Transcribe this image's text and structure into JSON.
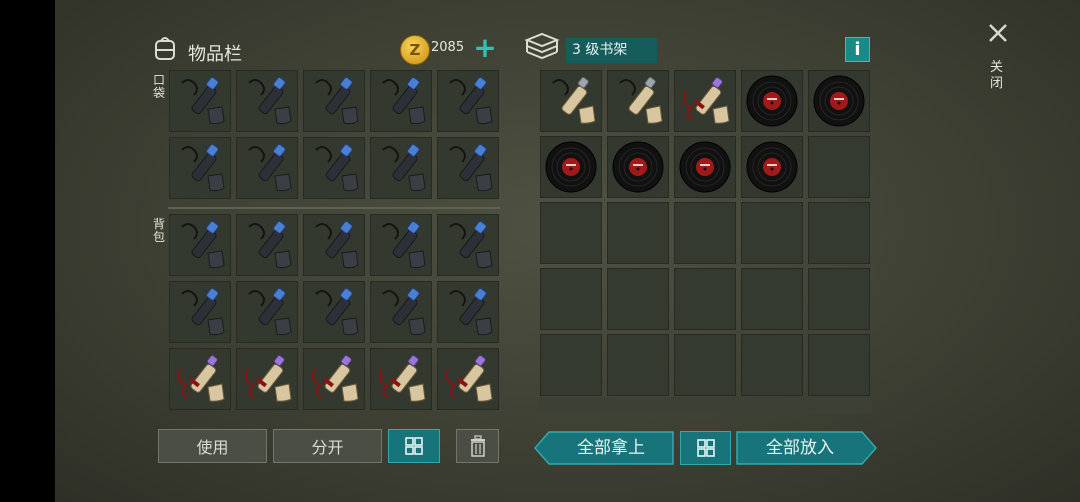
{
  "inventory": {
    "title": "物品栏",
    "coins": "2085",
    "pocket_label": "口袋",
    "backpack_label": "背包",
    "pocket_items": [
      "blue-tube",
      "blue-tube",
      "blue-tube",
      "blue-tube",
      "blue-tube",
      "blue-tube",
      "blue-tube",
      "blue-tube",
      "blue-tube",
      "blue-tube"
    ],
    "backpack_items": [
      "blue-tube",
      "blue-tube",
      "blue-tube",
      "blue-tube",
      "blue-tube",
      "blue-tube",
      "blue-tube",
      "blue-tube",
      "blue-tube",
      "blue-tube",
      "scroll-purple",
      "scroll-purple",
      "scroll-purple",
      "scroll-purple",
      "scroll-purple"
    ]
  },
  "container": {
    "title": "3 级书架",
    "items": [
      "scroll-gray",
      "scroll-gray",
      "scroll-purple",
      "vinyl-record",
      "vinyl-record",
      "vinyl-record",
      "vinyl-record",
      "vinyl-record",
      "vinyl-record",
      "",
      "",
      "",
      "",
      "",
      "",
      "",
      "",
      "",
      "",
      "",
      "",
      "",
      "",
      "",
      ""
    ]
  },
  "actions": {
    "use": "使用",
    "split": "分开",
    "take_all": "全部拿上",
    "put_all": "全部放入"
  },
  "close_label": "关闭",
  "colors": {
    "accent_teal": "#17747a",
    "plus_green": "#2fc3b4",
    "coin_gold": "#d9a21b"
  }
}
